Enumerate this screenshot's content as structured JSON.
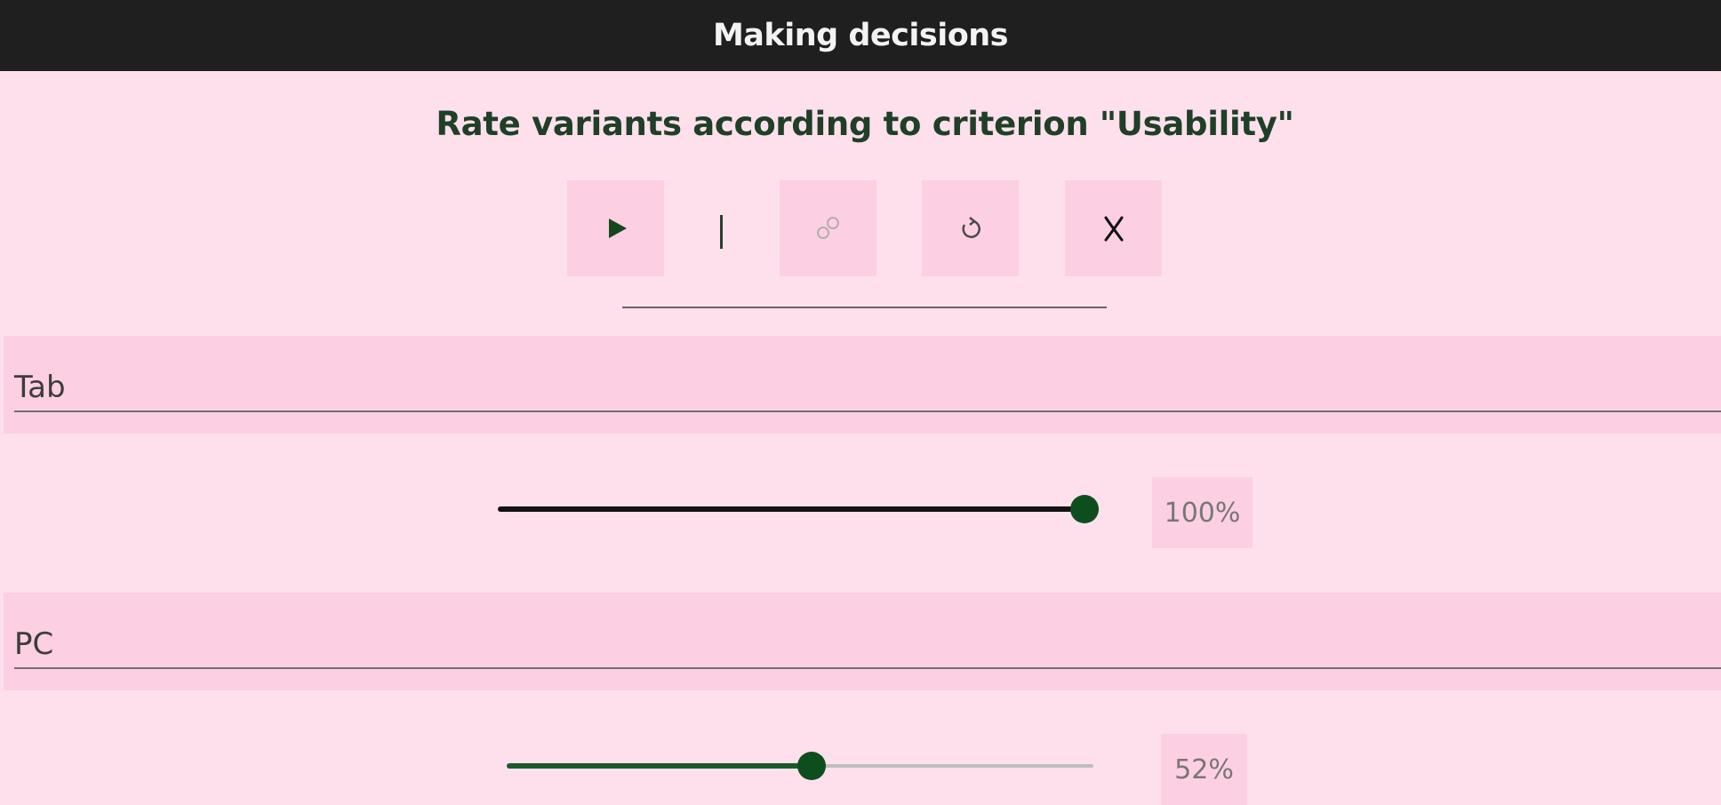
{
  "appbar": {
    "title": "Making decisions"
  },
  "main": {
    "heading": "Rate variants according to criterion \"Usability\""
  },
  "toolbar": {
    "buttons": [
      {
        "name": "play",
        "icon": "play-icon"
      },
      {
        "name": "link",
        "icon": "link-icon",
        "glyph": "☍"
      },
      {
        "name": "reset",
        "icon": "refresh-icon",
        "glyph": "↻"
      },
      {
        "name": "close",
        "icon": "close-icon",
        "glyph": "✗"
      }
    ]
  },
  "variants": [
    {
      "label": "Tab",
      "value_percent": 100,
      "value_text": "100%"
    },
    {
      "label": "PC",
      "value_percent": 52,
      "value_text": "52%"
    }
  ],
  "colors": {
    "background": "#fde0ec",
    "appbar": "#1f1f1f",
    "panel": "#fccfe2",
    "accent": "#0d4e1f",
    "heading": "#1f3f26"
  }
}
